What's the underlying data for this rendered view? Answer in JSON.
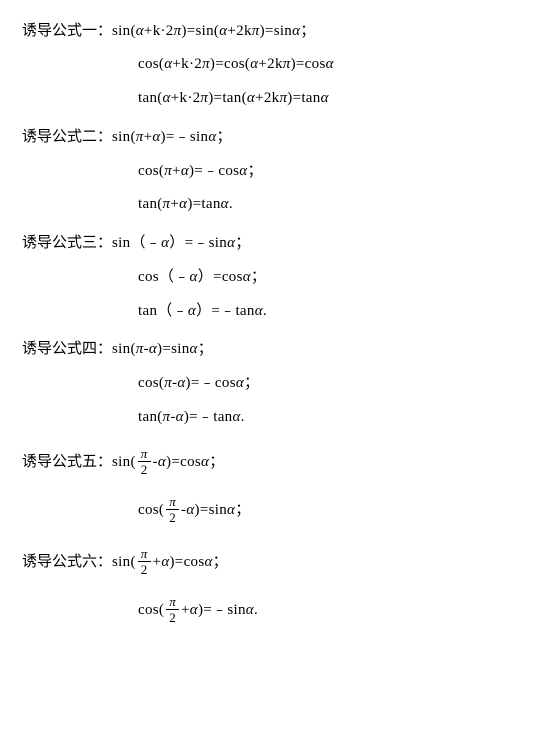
{
  "groups": [
    {
      "label": "诱导公式一：",
      "lines": [
        {
          "type": "plain",
          "text": "sin(α+k·2π)=sin(α+2kπ)=sinα；"
        },
        {
          "type": "plain",
          "text": "cos(α+k·2π)=cos(α+2kπ)=cosα"
        },
        {
          "type": "plain",
          "text": "tan(α+k·2π)=tan(α+2kπ)=tanα"
        }
      ]
    },
    {
      "label": "诱导公式二：",
      "lines": [
        {
          "type": "plain",
          "text": "sin(π+α)=﹣sinα；"
        },
        {
          "type": "plain",
          "text": "cos(π+α)=﹣cosα；"
        },
        {
          "type": "plain",
          "text": "tan(π+α)=tanα."
        }
      ]
    },
    {
      "label": "诱导公式三：",
      "lines": [
        {
          "type": "plain",
          "text": "sin（﹣α）=﹣sinα；"
        },
        {
          "type": "plain",
          "text": "cos（﹣α）=cosα；"
        },
        {
          "type": "plain",
          "text": "tan（﹣α）=﹣tanα."
        }
      ]
    },
    {
      "label": "诱导公式四：",
      "lines": [
        {
          "type": "plain",
          "text": "sin(π-α)=sinα；"
        },
        {
          "type": "plain",
          "text": "cos(π-α)=﹣cosα；"
        },
        {
          "type": "plain",
          "text": "tan(π-α)=﹣tanα."
        }
      ]
    },
    {
      "label": "诱导公式五：",
      "lines": [
        {
          "type": "frac",
          "pre": "sin(",
          "num": "π",
          "den": "2",
          "post": "-α)=cosα；"
        },
        {
          "type": "frac",
          "pre": "cos(",
          "num": "π",
          "den": "2",
          "post": "-α)=sinα；"
        }
      ]
    },
    {
      "label": "诱导公式六：",
      "lines": [
        {
          "type": "frac",
          "pre": "sin(",
          "num": "π",
          "den": "2",
          "post": "+α)=cosα；"
        },
        {
          "type": "frac",
          "pre": "cos(",
          "num": "π",
          "den": "2",
          "post": "+α)=﹣sinα."
        }
      ]
    }
  ]
}
